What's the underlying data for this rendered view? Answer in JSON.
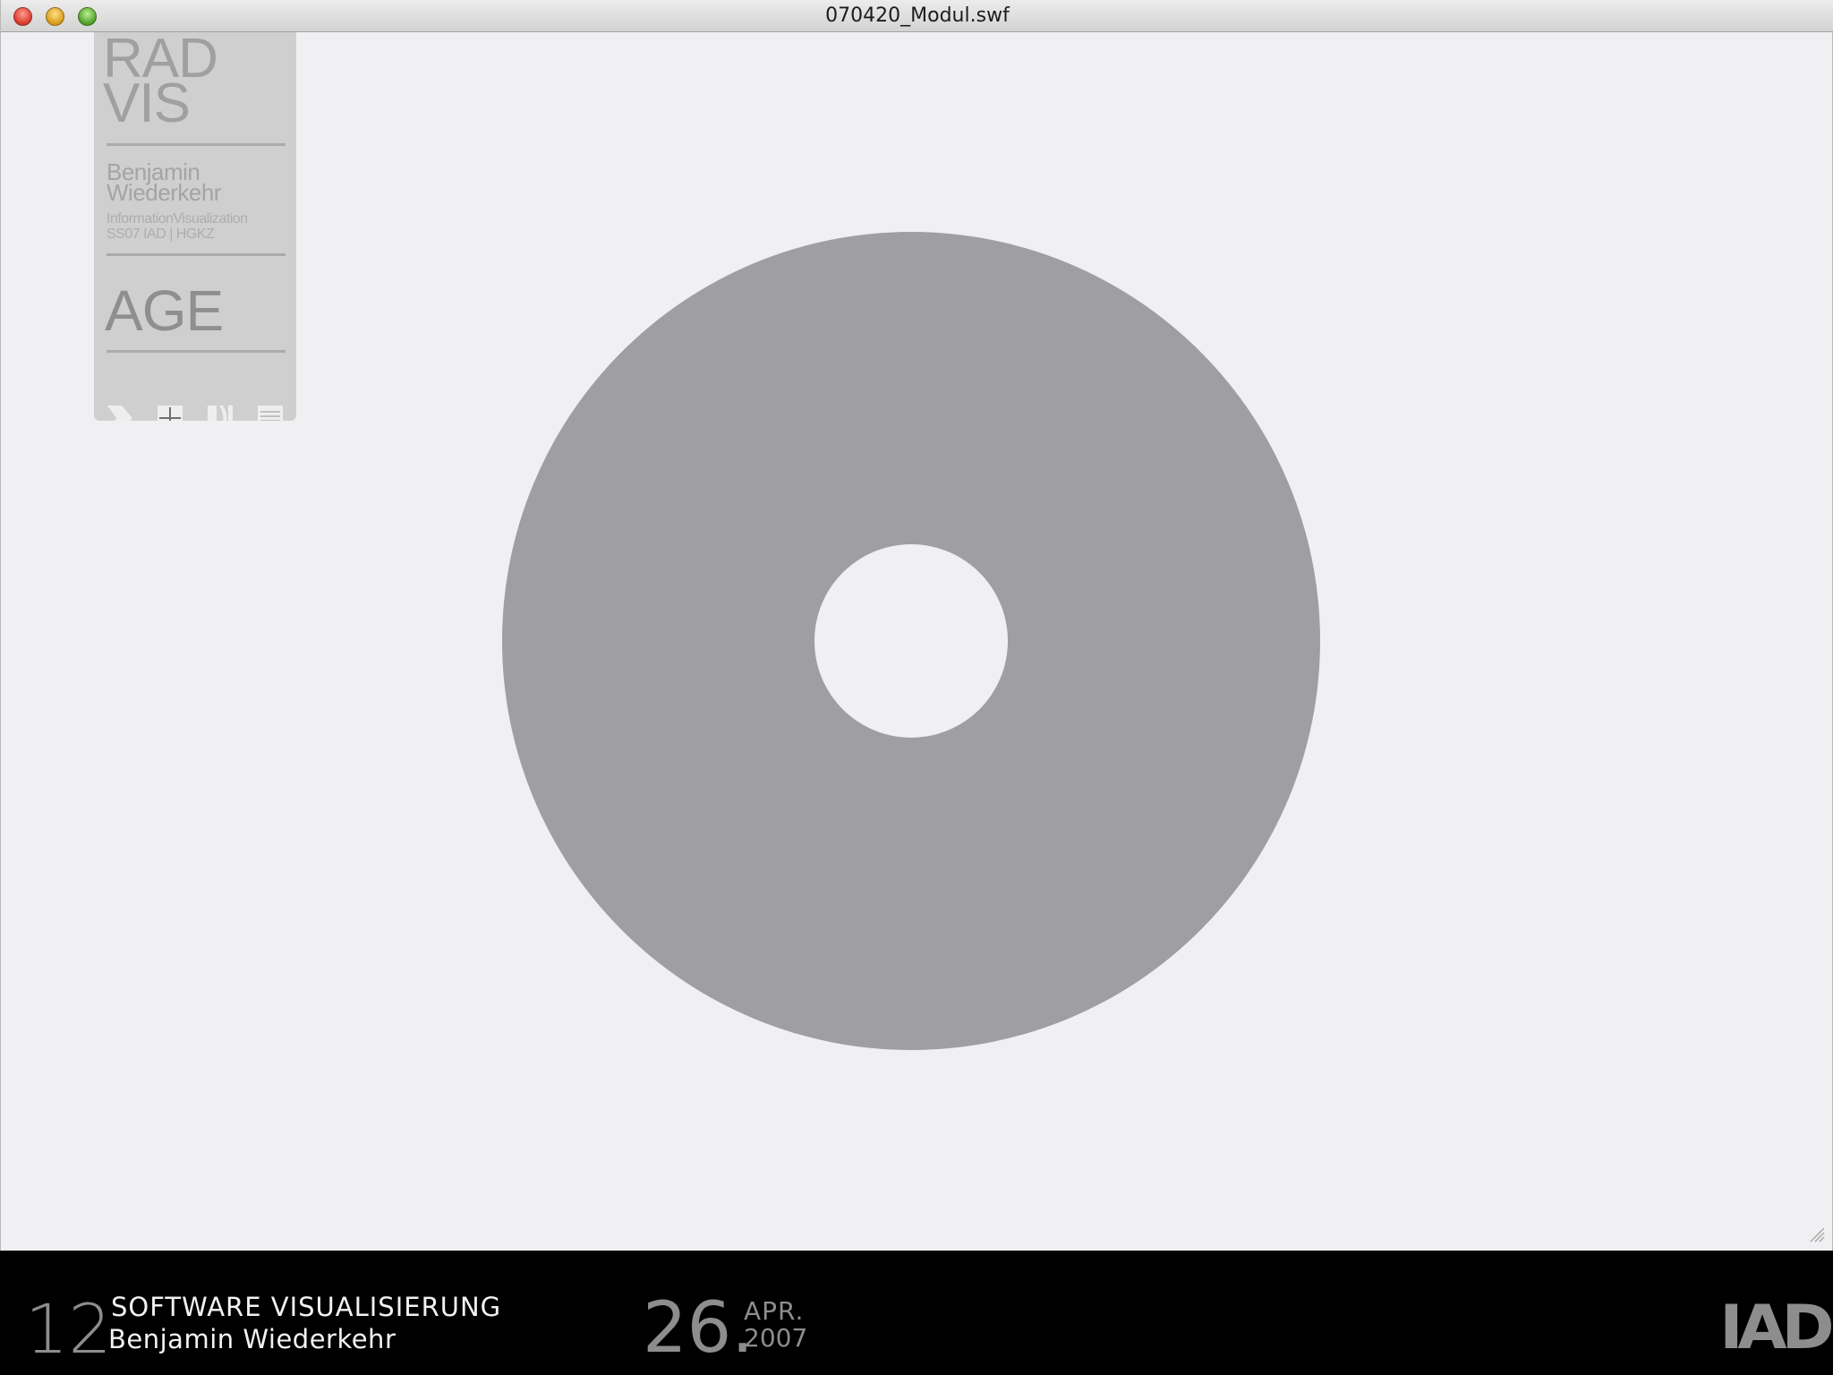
{
  "window": {
    "title": "070420_Modul.swf"
  },
  "panel": {
    "title_line1": "RAD",
    "title_line2": "VIS",
    "author_line1": "Benjamin",
    "author_line2": "Wiederkehr",
    "course_line1": "InformationVisualization",
    "course_line2": "SS07 IAD | HGKZ",
    "mode_label": "AGE",
    "icons": [
      "arrow-forward-icon",
      "plus-icon",
      "segments-icon",
      "list-icon"
    ]
  },
  "visualization": {
    "type": "radial-ring",
    "ring_color": "#9f9ea1",
    "background_color": "#f0eff1"
  },
  "footer": {
    "number": "12",
    "course_title": "SOFTWARE VISUALISIERUNG",
    "speaker": "Benjamin Wiederkehr",
    "day": "26.",
    "month": "APR.",
    "year": "2007",
    "logo": "IAD"
  }
}
